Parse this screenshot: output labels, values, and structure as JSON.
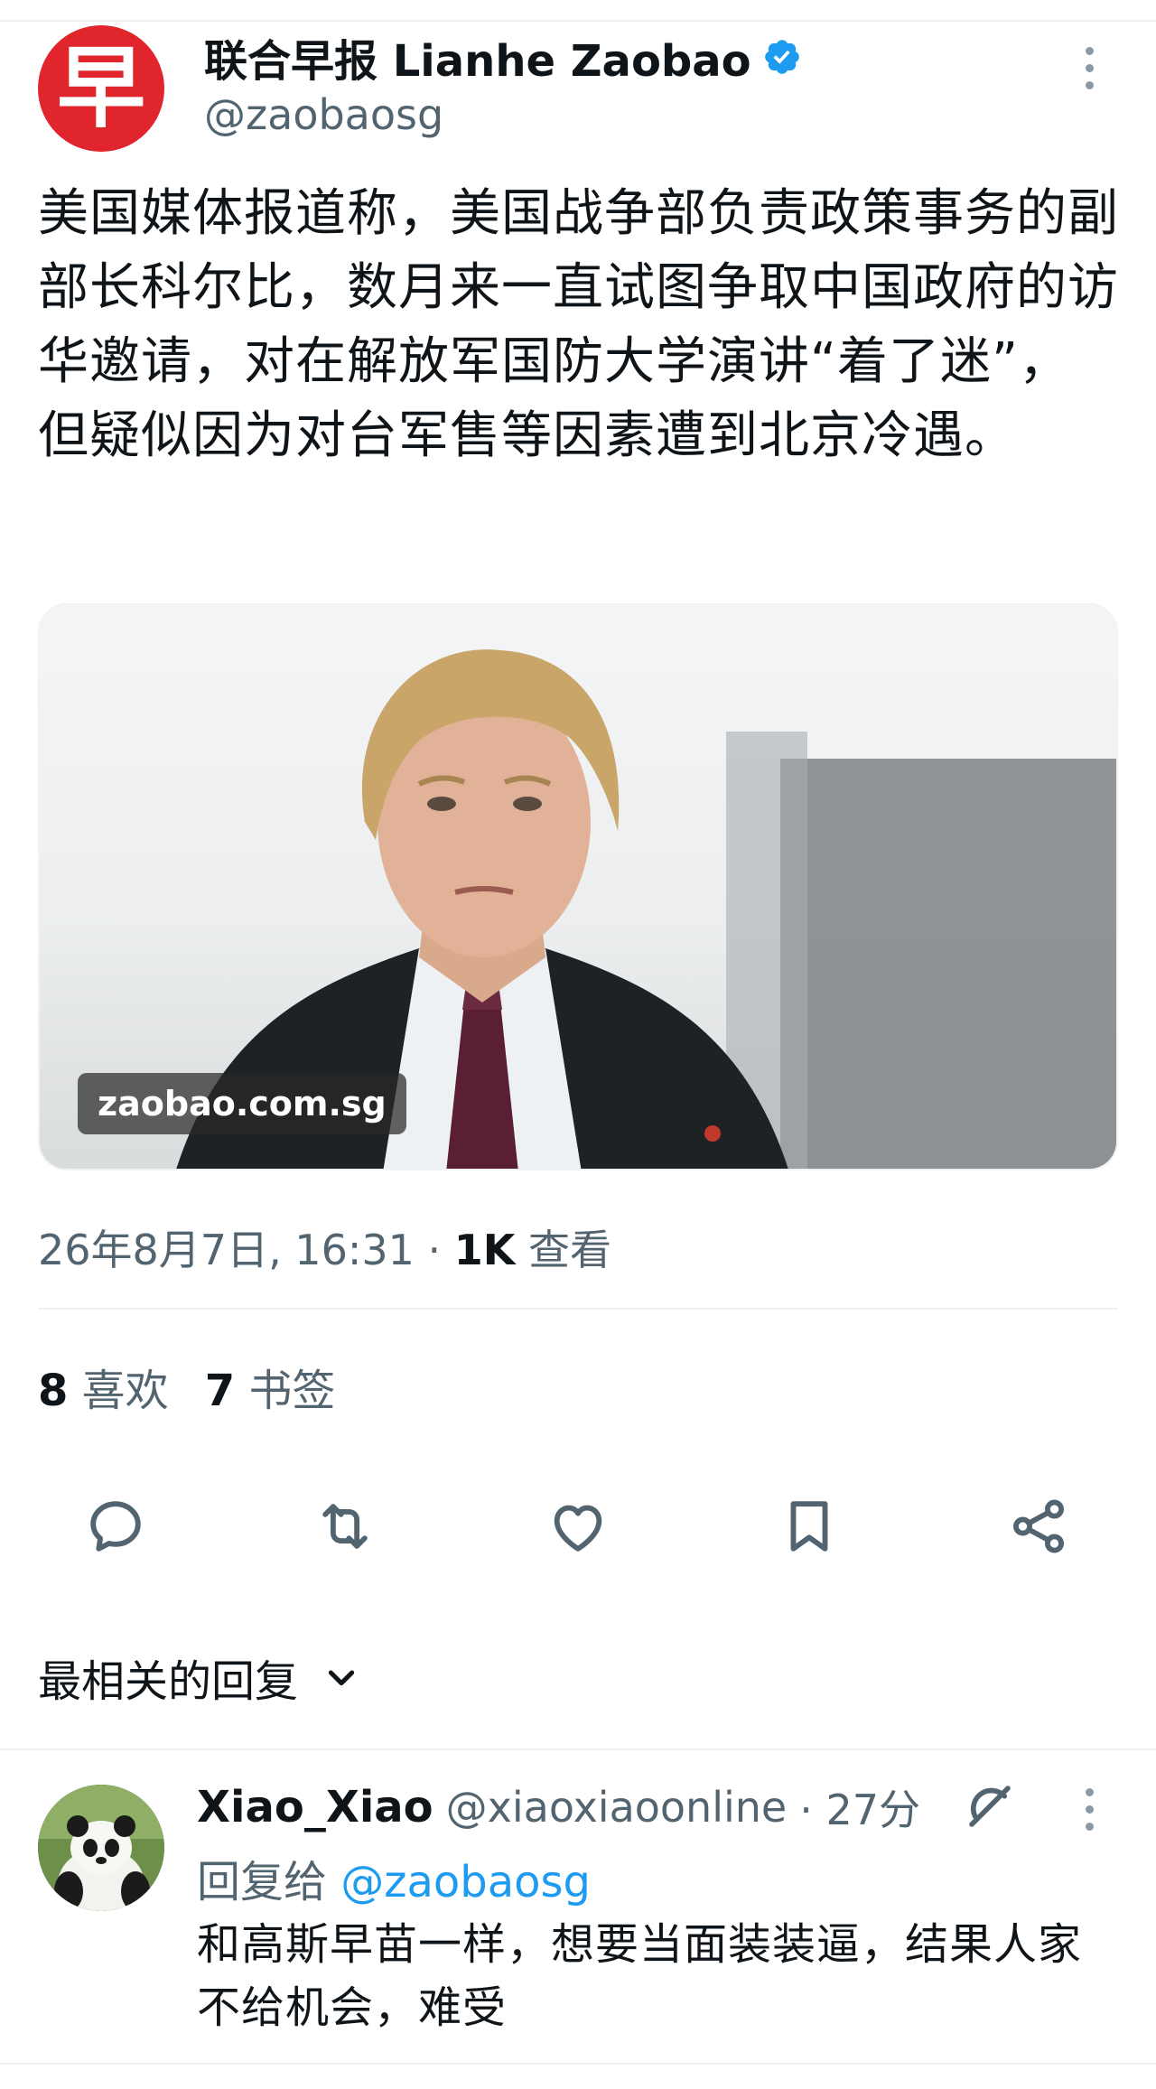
{
  "tweet": {
    "avatar_char": "早",
    "display_name": "联合早报 Lianhe Zaobao",
    "handle": "@zaobaosg",
    "text": "美国媒体报道称，美国战争部负责政策事务的副部长科尔比，数月来一直试图争取中国政府的访华邀请，对在解放军国防大学演讲“着了迷”，但疑似因为对台军售等因素遭到北京冷遇。",
    "media_watermark": "zaobao.com.sg",
    "timestamp": "26年8月7日, 16:31",
    "separator": " · ",
    "views_count": "1K",
    "views_label": "查看",
    "likes_count": "8",
    "likes_label": "喜欢",
    "bookmarks_count": "7",
    "bookmarks_label": "书签"
  },
  "actions": {
    "icons": [
      "reply-icon",
      "retweet-icon",
      "like-icon",
      "bookmark-icon",
      "share-icon"
    ]
  },
  "replies": {
    "sort_label": "最相关的回复",
    "items": [
      {
        "name": "Xiao_Xiao",
        "handle": "@xiaoxiaoonline",
        "time": "· 27分",
        "replying_label": "回复给",
        "replying_to": "@zaobaosg",
        "text": "和高斯早苗一样，想要当面装装逼，结果人家不给机会，难受"
      }
    ]
  },
  "colors": {
    "brand_red": "#e1252d",
    "verified_blue": "#1d9bf0",
    "text_primary": "#0f1419",
    "text_secondary": "#536471"
  }
}
